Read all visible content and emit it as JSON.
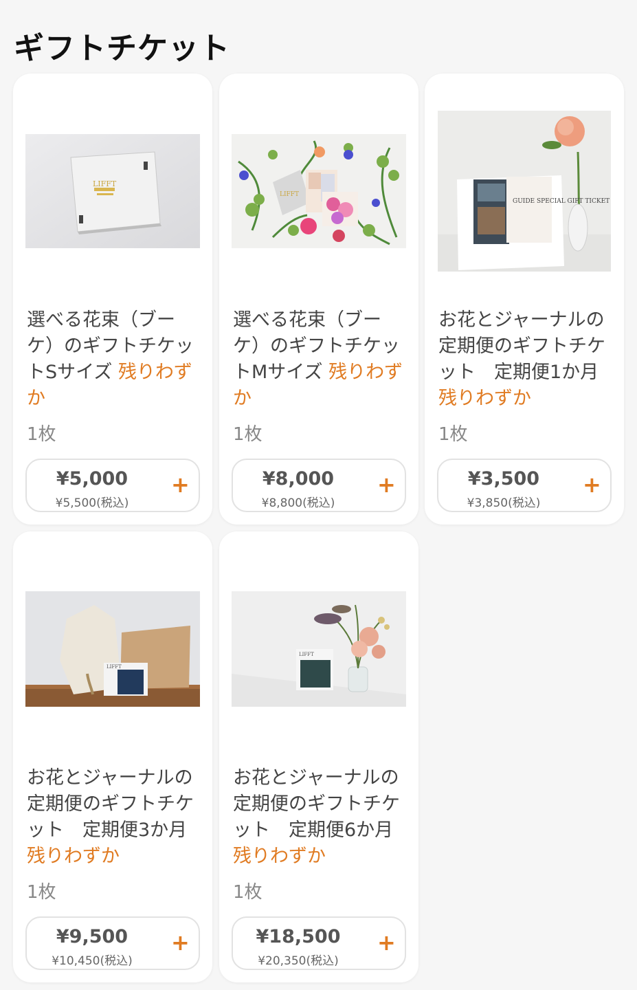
{
  "header": {
    "title": "ギフトチケット"
  },
  "accent_color": "#e07b22",
  "products": [
    {
      "title": "選べる花束（ブーケ）のギフトチケットSサイズ",
      "stock": "残りわずか",
      "qty": "1枚",
      "price": "¥5,000",
      "price_tax": "¥5,500(税込)",
      "add_icon": "plus-icon",
      "image_text": "LIFFT"
    },
    {
      "title": "選べる花束（ブーケ）のギフトチケットMサイズ",
      "stock": "残りわずか",
      "qty": "1枚",
      "price": "¥8,000",
      "price_tax": "¥8,800(税込)",
      "add_icon": "plus-icon",
      "image_text": "LIFFT"
    },
    {
      "title": "お花とジャーナルの定期便のギフトチケット　定期便1か月",
      "stock": "残りわずか",
      "qty": "1枚",
      "price": "¥3,500",
      "price_tax": "¥3,850(税込)",
      "add_icon": "plus-icon",
      "image_text": "GUIDE SPECIAL GIFT TICKET"
    },
    {
      "title": "お花とジャーナルの定期便のギフトチケット　定期便3か月",
      "stock": "残りわずか",
      "qty": "1枚",
      "price": "¥9,500",
      "price_tax": "¥10,450(税込)",
      "add_icon": "plus-icon",
      "image_text": "LIFFT"
    },
    {
      "title": "お花とジャーナルの定期便のギフトチケット　定期便6か月",
      "stock": "残りわずか",
      "qty": "1枚",
      "price": "¥18,500",
      "price_tax": "¥20,350(税込)",
      "add_icon": "plus-icon",
      "image_text": "LIFFT"
    }
  ]
}
